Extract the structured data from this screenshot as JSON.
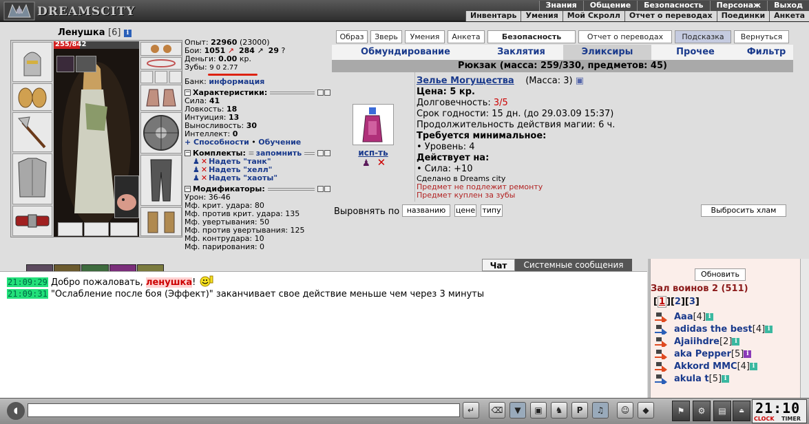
{
  "topbar": {
    "logo_text": "DREAMSCITY",
    "menu_row1": [
      "Знания",
      "Общение",
      "Безопасность",
      "Персонаж",
      "Выход"
    ],
    "menu_row2": [
      "Инвентарь",
      "Умения",
      "Мой Скролл",
      "Отчет о переводах",
      "Поединки",
      "Анкета"
    ]
  },
  "character": {
    "name": "Ленушка",
    "level": "[6]",
    "hp_text": "255/842",
    "hp_fraction": 0.303
  },
  "stats": {
    "exp_label": "Опыт:",
    "exp_value": "22960",
    "exp_next": "(23000)",
    "fights_label": "Бои:",
    "fights_won": "1051",
    "fights_lost": "284",
    "fights_draw": "29",
    "money_label": "Деньги:",
    "money_value": "0.00",
    "money_unit": "кр.",
    "teeth_label": "Зубы:",
    "teeth_values": "9 0 2.77",
    "bank_label": "Банк:",
    "bank_link": "информация",
    "characteristics_title": "Характеристики:",
    "strength": "Сила:",
    "strength_v": "41",
    "agility": "Ловкость:",
    "agility_v": "18",
    "intuition": "Интуиция:",
    "intuition_v": "13",
    "endurance": "Выносливость:",
    "endurance_v": "30",
    "intellect": "Интеллект:",
    "intellect_v": "0",
    "abilities_link": "+ Способности",
    "training_link": "Обучение",
    "sets_title": "Комплекты:",
    "remember_link": "запомнить",
    "sets": [
      "Надеть \"танк\"",
      "Надеть \"хелл\"",
      "Надеть \"хаоты\""
    ],
    "modifiers_title": "Модификаторы:",
    "modifiers": [
      "Урон: 36-46",
      "Мф. крит. удара: 80",
      "Мф. против крит. удара: 135",
      "Мф. увертывания: 50",
      "Мф. против увертывания: 125",
      "Мф. контрудара: 10",
      "Мф. парирования: 0"
    ]
  },
  "actions": [
    "Образ",
    "Зверь",
    "Умения",
    "Анкета",
    "Безопасность",
    "Отчет о переводах",
    "Подсказка",
    "Вернуться"
  ],
  "tabs": [
    "Обмундирование",
    "Заклятия",
    "Эликсиры",
    "Прочее",
    "Фильтр"
  ],
  "backpack": "Рюкзак (масса: 259/330, предметов: 45)",
  "item": {
    "use_label": "исп-ть",
    "name": "Зелье Могущества",
    "mass": "(Масса: 3)",
    "price": "Цена: 5 кр.",
    "durability_label": "Долговечность:",
    "durability_value": "3/5",
    "expiry": "Срок годности: 15 дн. (до 29.03.09 15:37)",
    "duration": "Продолжительность действия магии: 6 ч.",
    "requires_title": "Требуется минимальное:",
    "requires_level": "• Уровень: 4",
    "effects_title": "Действует на:",
    "effects_strength": "• Сила: +10",
    "made_in": "Сделано в Dreams city",
    "no_repair": "Предмет не подлежит ремонту",
    "bought_teeth": "Предмет куплен за зубы"
  },
  "sort": {
    "label": "Выровнять по",
    "by_name": "названию",
    "by_price": "цене",
    "by_type": "типу",
    "junk": "Выбросить хлам"
  },
  "chat": {
    "tab_chat": "Чат",
    "tab_system": "Системные сообщения",
    "messages": [
      {
        "time": "21:09:29",
        "text_before": "Добро пожаловать,",
        "nick": "ленушка",
        "text_after": "!"
      },
      {
        "time": "21:09:31",
        "text": "\"Ослабление после боя (Эффект)\" заканчивает свое действие меньше чем через 3 минуты"
      }
    ]
  },
  "users": {
    "refresh": "Обновить",
    "room": "Зал воинов 2 (511)",
    "pages": [
      "1",
      "2",
      "3"
    ],
    "list": [
      {
        "name": "Aaa",
        "level": "[4]"
      },
      {
        "name": "adidas the best",
        "level": "[4]"
      },
      {
        "name": "Ajaiihdre",
        "level": "[2]"
      },
      {
        "name": "aka Pepper",
        "level": "[5]"
      },
      {
        "name": "Akkord MMC",
        "level": "[4]"
      },
      {
        "name": "akula t",
        "level": "[5]"
      }
    ]
  },
  "clock": {
    "time": "21:10",
    "clock_label": "CLOCK",
    "timer_label": "TIMER"
  }
}
